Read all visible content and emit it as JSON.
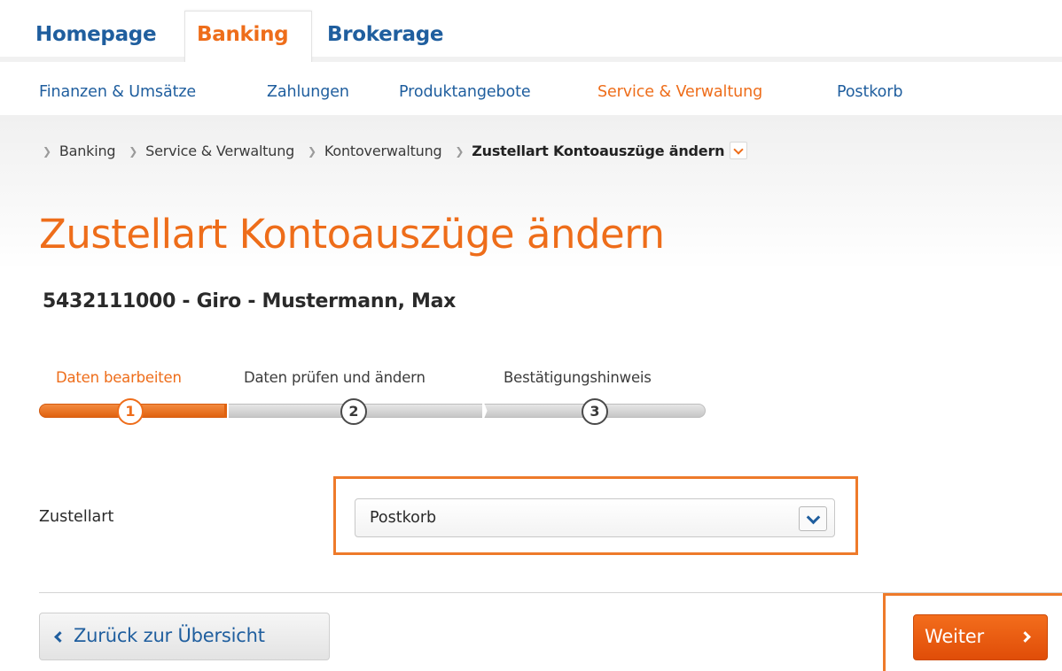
{
  "top_tabs": [
    {
      "label": "Homepage",
      "active": false
    },
    {
      "label": "Banking",
      "active": true
    },
    {
      "label": "Brokerage",
      "active": false
    }
  ],
  "sub_nav": [
    {
      "label": "Finanzen & Umsätze",
      "active": false
    },
    {
      "label": "Zahlungen",
      "active": false
    },
    {
      "label": "Produktangebote",
      "active": false
    },
    {
      "label": "Service & Verwaltung",
      "active": true
    },
    {
      "label": "Postkorb",
      "active": false
    }
  ],
  "breadcrumb": {
    "items": [
      "Banking",
      "Service & Verwaltung",
      "Kontoverwaltung"
    ],
    "current": "Zustellart Kontoauszüge ändern",
    "dropdown_icon": "chevron-down-icon"
  },
  "page_title": "Zustellart Kontoauszüge ändern",
  "account": "5432111000 - Giro - Mustermann, Max",
  "steps": [
    {
      "number": "1",
      "label": "Daten bearbeiten",
      "active": true
    },
    {
      "number": "2",
      "label": "Daten prüfen und ändern",
      "active": false
    },
    {
      "number": "3",
      "label": "Bestätigungshinweis",
      "active": false
    }
  ],
  "progress": {
    "current_step": 1,
    "total_steps": 3
  },
  "form": {
    "label": "Zustellart",
    "select_value": "Postkorb",
    "select_icon": "chevron-down-icon"
  },
  "buttons": {
    "back_label": "Zurück zur Übersicht",
    "next_label": "Weiter"
  },
  "colors": {
    "accent": "#ee6d1a",
    "link": "#1f5e9e",
    "highlight": "#ee7a2a"
  }
}
